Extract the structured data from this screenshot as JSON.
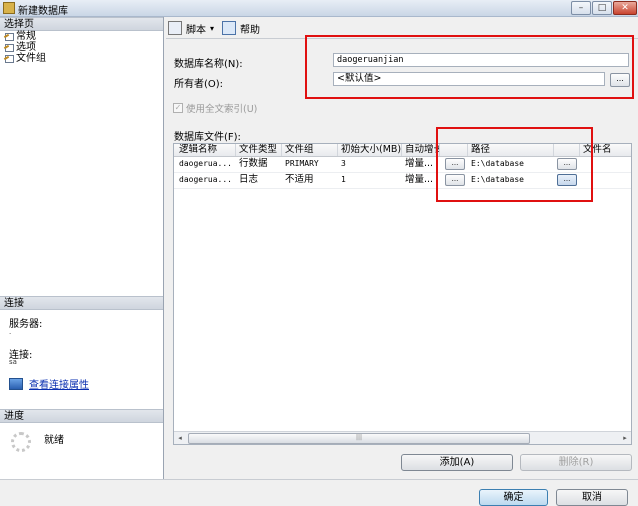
{
  "window": {
    "title": "新建数据库"
  },
  "left": {
    "select_page_header": "选择页",
    "pages": [
      "常规",
      "选项",
      "文件组"
    ],
    "connection_header": "连接",
    "server_label": "服务器:",
    "server_value": ".",
    "connection_label": "连接:",
    "connection_value": "sa",
    "view_connection_link": "查看连接属性",
    "progress_header": "进度",
    "progress_status": "就绪"
  },
  "toolbar": {
    "script_label": "脚本",
    "help_label": "帮助"
  },
  "form": {
    "db_name_label": "数据库名称(N):",
    "db_name_value": "daogeruanjian",
    "owner_label": "所有者(O):",
    "owner_value": "<默认值>",
    "browse_label": "...",
    "fulltext_label": "使用全文索引(U)",
    "files_label": "数据库文件(F):"
  },
  "grid": {
    "columns": [
      "逻辑名称",
      "文件类型",
      "文件组",
      "初始大小(MB)",
      "自动增长",
      "",
      "路径",
      "",
      "文件名"
    ],
    "rows": [
      {
        "logical": "daogerua...",
        "type": "行数据",
        "filegroup": "PRIMARY",
        "size": "3",
        "growth": "增量...",
        "btn1": "...",
        "path": "E:\\database",
        "btn2": "..."
      },
      {
        "logical": "daogerua...",
        "type": "日志",
        "filegroup": "不适用",
        "size": "1",
        "growth": "增量...",
        "btn1": "...",
        "path": "E:\\database",
        "btn2": "..."
      }
    ],
    "scroll_left": "◂",
    "scroll_right": "▸",
    "scroll_thumb": "|||"
  },
  "buttons": {
    "add": "添加(A)",
    "remove": "删除(R)",
    "ok": "确定",
    "cancel": "取消"
  },
  "window_controls": {
    "minimize": "–",
    "maximize": "□",
    "close": "✕"
  },
  "colors": {
    "highlight": "#e01010",
    "link": "#0a2fb0"
  }
}
